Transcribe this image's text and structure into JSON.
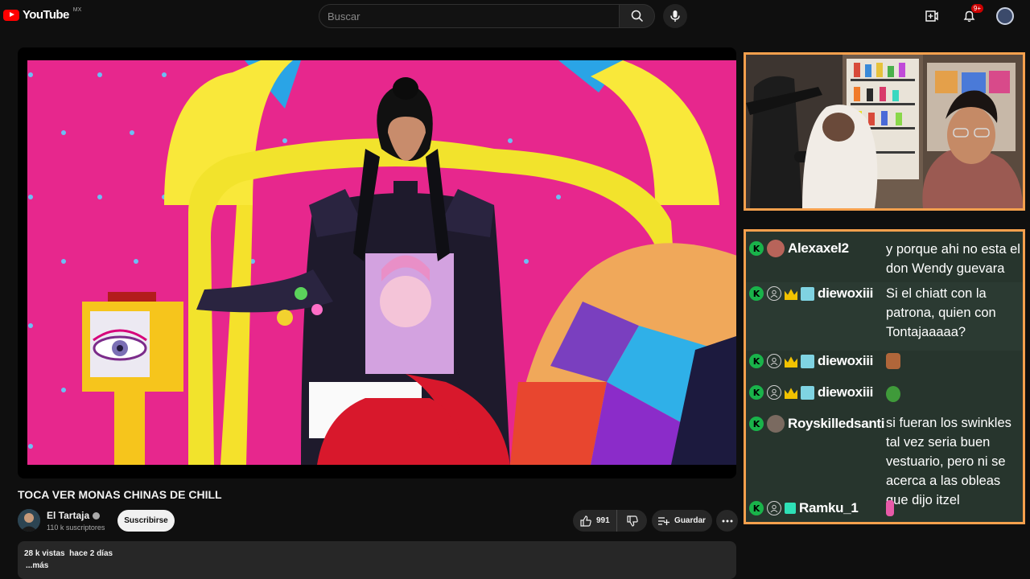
{
  "header": {
    "logo_text": "YouTube",
    "country_code": "MX",
    "search_placeholder": "Buscar",
    "notification_count": "9+"
  },
  "video": {
    "title": "TOCA VER MONAS CHINAS DE CHILL",
    "channel_name": "El Tartaja",
    "subscribers": "110 k suscriptores",
    "subscribe_label": "Suscribirse",
    "like_count": "991",
    "save_label": "Guardar",
    "stats": "28 k vistas  hace 2 días",
    "more_label": "...más"
  },
  "chat": {
    "messages": [
      {
        "user": "Alexaxel2",
        "text": "y porque ahi no esta el don Wendy guevara"
      },
      {
        "user": "diewoxiii",
        "text": "Si el chiatt con la patrona, quien con Tontajaaaaa?"
      },
      {
        "user": "diewoxiii",
        "text": ""
      },
      {
        "user": "diewoxiii",
        "text": ""
      },
      {
        "user": "Royskilledsanti",
        "text": "si fueran los swinkles tal vez seria buen vestuario, pero ni se acerca a las obleas que dijo itzel"
      },
      {
        "user": "Ramku_1",
        "text": ""
      }
    ]
  },
  "colors": {
    "accent_red": "#ff0000",
    "overlay_border": "#f6a04d",
    "kick_green": "#19b34a",
    "chat_bg": "#27352d"
  }
}
